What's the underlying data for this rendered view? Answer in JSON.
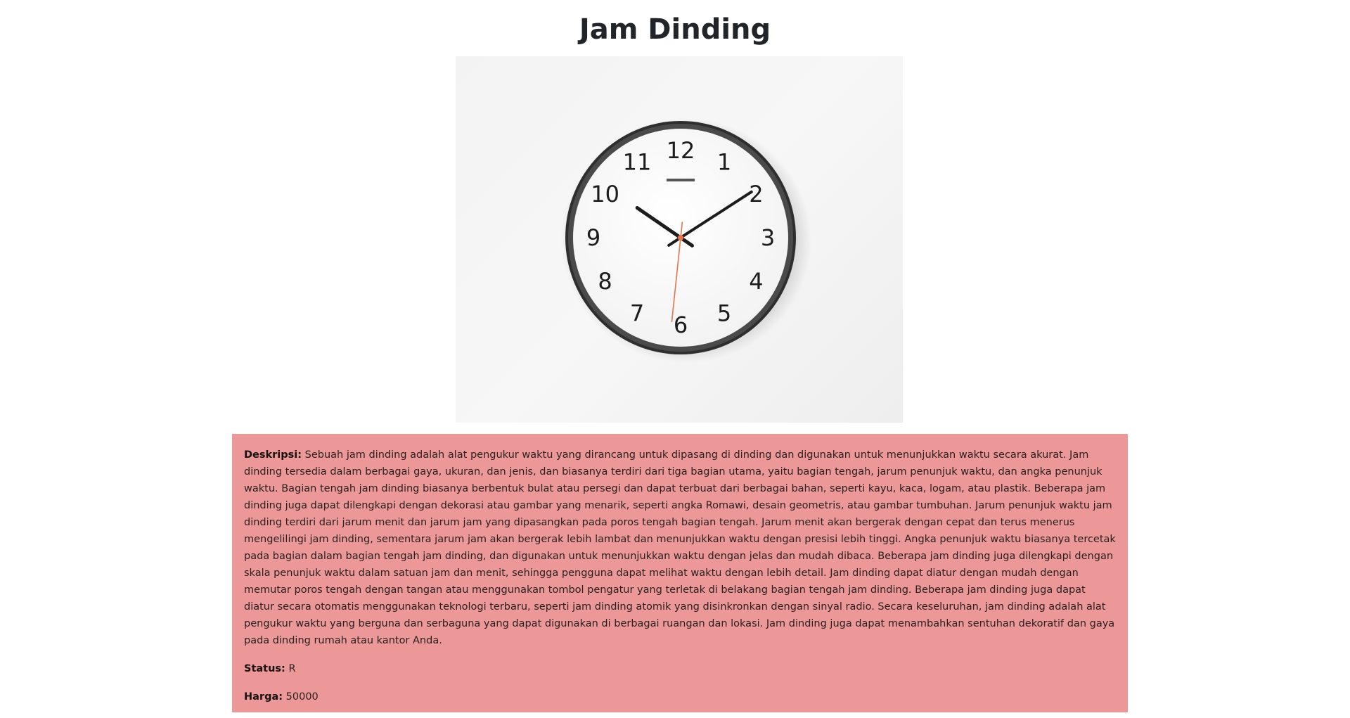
{
  "product": {
    "title": "Jam Dinding",
    "image": {
      "icon": "wall-clock-photo",
      "clock_numerals": [
        "12",
        "1",
        "2",
        "3",
        "4",
        "5",
        "6",
        "7",
        "8",
        "9",
        "10",
        "11"
      ],
      "clock_time": "10:09:31"
    },
    "details": {
      "description_label": "Deskripsi:",
      "description": "Sebuah jam dinding adalah alat pengukur waktu yang dirancang untuk dipasang di dinding dan digunakan untuk menunjukkan waktu secara akurat. Jam dinding tersedia dalam berbagai gaya, ukuran, dan jenis, dan biasanya terdiri dari tiga bagian utama, yaitu bagian tengah, jarum penunjuk waktu, dan angka penunjuk waktu. Bagian tengah jam dinding biasanya berbentuk bulat atau persegi dan dapat terbuat dari berbagai bahan, seperti kayu, kaca, logam, atau plastik. Beberapa jam dinding juga dapat dilengkapi dengan dekorasi atau gambar yang menarik, seperti angka Romawi, desain geometris, atau gambar tumbuhan. Jarum penunjuk waktu jam dinding terdiri dari jarum menit dan jarum jam yang dipasangkan pada poros tengah bagian tengah. Jarum menit akan bergerak dengan cepat dan terus menerus mengelilingi jam dinding, sementara jarum jam akan bergerak lebih lambat dan menunjukkan waktu dengan presisi lebih tinggi. Angka penunjuk waktu biasanya tercetak pada bagian dalam bagian tengah jam dinding, dan digunakan untuk menunjukkan waktu dengan jelas dan mudah dibaca. Beberapa jam dinding juga dilengkapi dengan skala penunjuk waktu dalam satuan jam dan menit, sehingga pengguna dapat melihat waktu dengan lebih detail. Jam dinding dapat diatur dengan mudah dengan memutar poros tengah dengan tangan atau menggunakan tombol pengatur yang terletak di belakang bagian tengah jam dinding. Beberapa jam dinding juga dapat diatur secara otomatis menggunakan teknologi terbaru, seperti jam dinding atomik yang disinkronkan dengan sinyal radio. Secara keseluruhan, jam dinding adalah alat pengukur waktu yang berguna dan serbaguna yang dapat digunakan di berbagai ruangan dan lokasi. Jam dinding juga dapat menambahkan sentuhan dekoratif dan gaya pada dinding rumah atau kantor Anda.",
      "status_label": "Status:",
      "status": "R",
      "price_label": "Harga:",
      "price": "50000"
    }
  },
  "colors": {
    "details_background": "#ec9898",
    "page_background": "#ffffff",
    "clock_rim": "#2a2a2a",
    "second_hand": "#e8734a"
  }
}
